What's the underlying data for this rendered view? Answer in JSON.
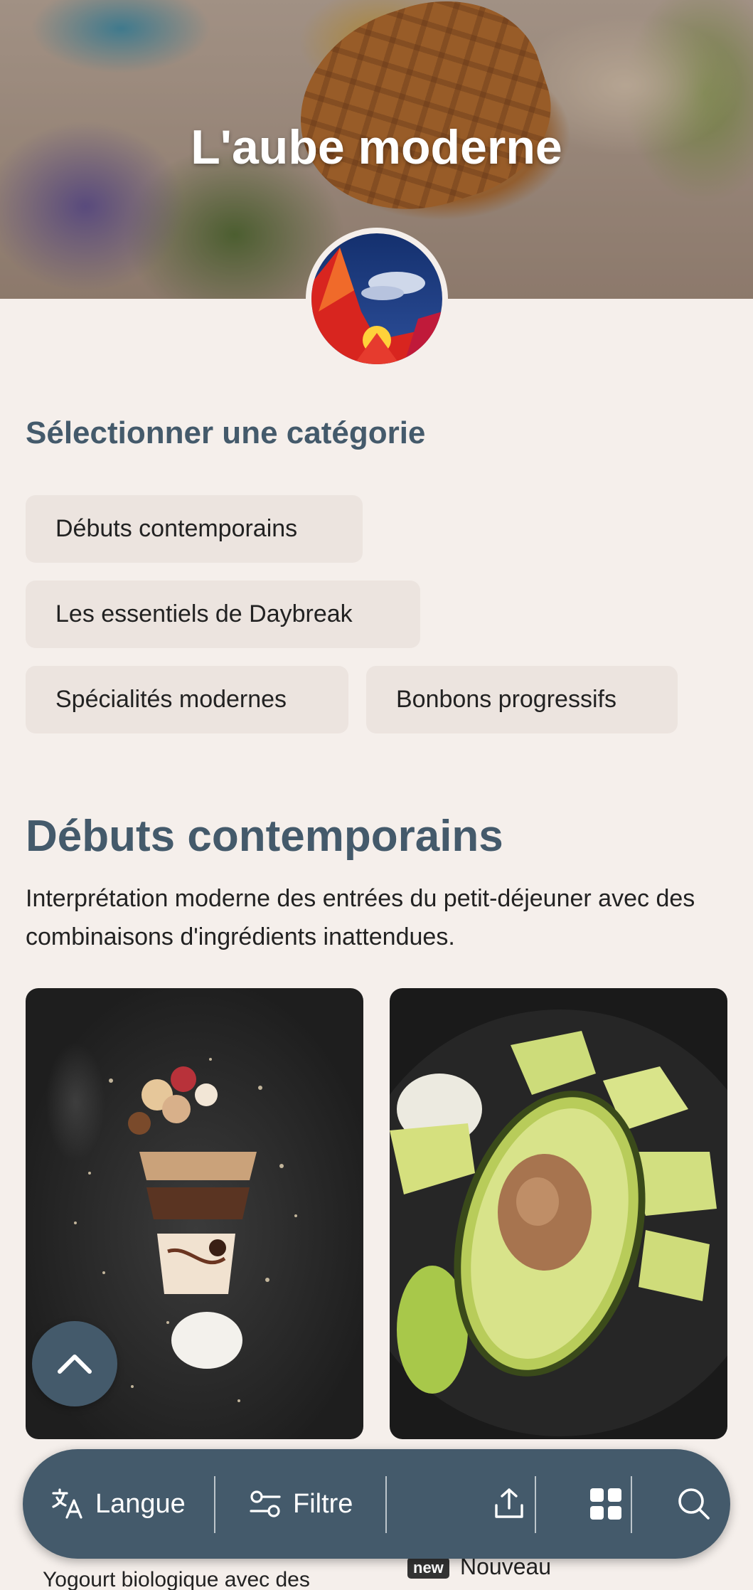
{
  "hero": {
    "title": "L'aube moderne"
  },
  "categories": {
    "heading": "Sélectionner une catégorie",
    "items": [
      {
        "label": "Débuts contemporains"
      },
      {
        "label": "Les essentiels de Daybreak"
      },
      {
        "label": "Spécialités modernes"
      },
      {
        "label": "Bonbons progressifs"
      }
    ]
  },
  "section": {
    "title": "Débuts contemporains",
    "description": "Interprétation moderne des entrées du petit-déjeuner avec des combinaisons d'ingrédients inattendues."
  },
  "cards": [
    {
      "caption_peek": "Yogourt biologique avec des",
      "image_icon": "layered-dessert-image"
    },
    {
      "badge": "new",
      "badge_label": "Nouveau",
      "image_icon": "avocado-image"
    }
  ],
  "toolbar": {
    "language_label": "Langue",
    "filter_label": "Filtre",
    "icons": [
      "translate-icon",
      "filter-icon",
      "share-icon",
      "grid-icon",
      "search-icon"
    ]
  },
  "colors": {
    "accent": "#445a6b",
    "background": "#f5efeb",
    "chip": "#ece4df"
  }
}
